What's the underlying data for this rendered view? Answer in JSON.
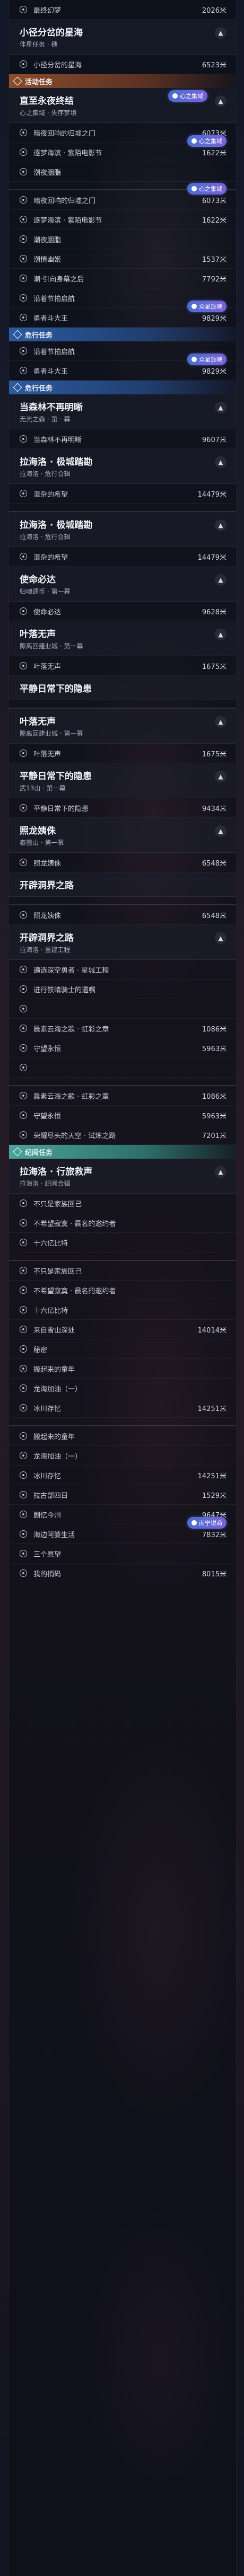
{
  "colors": {
    "main": "#8a4d2d",
    "side": "#2c5aa0",
    "world": "#4aa39a",
    "badge": "#5f68d4"
  },
  "units": "米",
  "rows": [
    {
      "t": "row",
      "label": "最终幻梦",
      "dist": "2026米"
    },
    {
      "t": "header",
      "title": "小径分岔的星海",
      "sub": "伴星任务 · 穗",
      "chev": "▲"
    },
    {
      "t": "row",
      "label": "小径分岔的星海",
      "dist": "6523米"
    },
    {
      "t": "section",
      "kind": "main",
      "label": "活动任务"
    },
    {
      "t": "header",
      "title": "直至永夜终结",
      "sub": "心之集域 · 失序梦境",
      "chev": "▲",
      "badge": "心之集域"
    },
    {
      "t": "row",
      "label": "暗夜回响的归墟之门",
      "dist": "6073米"
    },
    {
      "t": "row",
      "label": "逐梦海滨 · 紫陌电影节",
      "dist": "1622米",
      "badge": "心之集域"
    },
    {
      "t": "row",
      "label": "潮夜胭脂",
      "dist": ""
    },
    {
      "t": "divider"
    },
    {
      "t": "row",
      "label": "暗夜回响的归墟之门",
      "dist": "6073米",
      "badge": "心之集域"
    },
    {
      "t": "row",
      "label": "逐梦海滨 · 紫陌电影节",
      "dist": "1622米"
    },
    {
      "t": "row",
      "label": "潮夜胭脂",
      "dist": ""
    },
    {
      "t": "row",
      "label": "潮情幽姬",
      "dist": "1537米"
    },
    {
      "t": "row",
      "label": "潮·引向身幕之后",
      "dist": "7792米"
    },
    {
      "t": "row",
      "label": "沿着节拍启航",
      "dist": ""
    },
    {
      "t": "row",
      "label": "勇者斗大王",
      "dist": "9829米",
      "badge": "众星放映"
    },
    {
      "t": "section",
      "kind": "side",
      "label": "危行任务"
    },
    {
      "t": "row",
      "label": "沿着节拍启航",
      "dist": ""
    },
    {
      "t": "row",
      "label": "勇者斗大王",
      "dist": "9829米",
      "badge": "众星放映"
    },
    {
      "t": "section",
      "kind": "side",
      "label": "危行任务"
    },
    {
      "t": "header",
      "title": "当森林不再明晰",
      "sub": "无光之森 · 第一幕",
      "chev": "▲"
    },
    {
      "t": "row",
      "label": "当森林不再明晰",
      "dist": "9607米"
    },
    {
      "t": "header",
      "title": "拉海洛 · 极城踏勘",
      "sub": "拉海洛 · 危行合辑",
      "chev": "▲"
    },
    {
      "t": "row",
      "label": "混杂的希望",
      "dist": "14479米"
    },
    {
      "t": "divider"
    },
    {
      "t": "header",
      "title": "拉海洛 · 极城踏勘",
      "sub": "拉海洛 · 危行合辑",
      "chev": "▲"
    },
    {
      "t": "row",
      "label": "混杂的希望",
      "dist": "14479米"
    },
    {
      "t": "header",
      "title": "使命必达",
      "sub": "归魂遗币 · 第一幕",
      "chev": "▲"
    },
    {
      "t": "row",
      "label": "使命必达",
      "dist": "9628米"
    },
    {
      "t": "header",
      "title": "叶落无声",
      "sub": "隙离回建业城 · 第一幕",
      "chev": "▲"
    },
    {
      "t": "row",
      "label": "叶落无声",
      "dist": "1675米"
    },
    {
      "t": "header",
      "title": "平静日常下的隐患",
      "sub": "",
      "chev": ""
    },
    {
      "t": "divider"
    },
    {
      "t": "header",
      "title": "叶落无声",
      "sub": "隙离回建业城 · 第一幕",
      "chev": "▲"
    },
    {
      "t": "row",
      "label": "叶落无声",
      "dist": "1675米"
    },
    {
      "t": "header",
      "title": "平静日常下的隐患",
      "sub": "武13山 · 第一幕",
      "chev": "▲"
    },
    {
      "t": "row",
      "label": "平静日常下的隐患",
      "dist": "9434米"
    },
    {
      "t": "header",
      "title": "照龙姨侏",
      "sub": "泰茵山 · 第一幕",
      "chev": "▲"
    },
    {
      "t": "row",
      "label": "照龙姨侏",
      "dist": "6548米"
    },
    {
      "t": "header",
      "title": "开辟洞界之路",
      "sub": "",
      "chev": ""
    },
    {
      "t": "divider"
    },
    {
      "t": "row",
      "label": "照龙姨侏",
      "dist": "6548米"
    },
    {
      "t": "header",
      "title": "开辟洞界之路",
      "sub": "拉海洛 · 重建工程",
      "chev": "▲"
    },
    {
      "t": "row",
      "label": "遍选深空勇者 · 星城工程",
      "dist": ""
    },
    {
      "t": "row",
      "label": "进行铁晴骑士的遗嘱",
      "dist": ""
    },
    {
      "t": "row",
      "label": "",
      "dist": ""
    },
    {
      "t": "row",
      "label": "晨素云海之歌 · 虹彩之章",
      "dist": "1086米"
    },
    {
      "t": "row",
      "label": "守望永恒",
      "dist": "5963米"
    },
    {
      "t": "row",
      "label": "",
      "dist": ""
    },
    {
      "t": "divider"
    },
    {
      "t": "row",
      "label": "晨素云海之歌 · 虹彩之章",
      "dist": "1086米"
    },
    {
      "t": "row",
      "label": "守望永恒",
      "dist": "5963米"
    },
    {
      "t": "row",
      "label": "荣耀尽头的天空 · 试炼之路",
      "dist": "7201米"
    },
    {
      "t": "section",
      "kind": "world",
      "label": "纪闻任务"
    },
    {
      "t": "header",
      "title": "拉海洛 · 行旅救声",
      "sub": "拉海洛 · 纪闻合辑",
      "chev": "▲"
    },
    {
      "t": "row",
      "label": "不只是家族回己",
      "dist": ""
    },
    {
      "t": "row",
      "label": "不希望寂寞 · 晨名的邀约者",
      "dist": ""
    },
    {
      "t": "row",
      "label": "十六亿比特",
      "dist": ""
    },
    {
      "t": "divider"
    },
    {
      "t": "row",
      "label": "不只是家族回己",
      "dist": ""
    },
    {
      "t": "row",
      "label": "不希望寂寞 · 晨名的邀约者",
      "dist": ""
    },
    {
      "t": "row",
      "label": "十六亿比特",
      "dist": ""
    },
    {
      "t": "row",
      "label": "来自雪山深处",
      "dist": "14014米"
    },
    {
      "t": "row",
      "label": "秘密",
      "dist": ""
    },
    {
      "t": "row",
      "label": "搬起来的童年",
      "dist": ""
    },
    {
      "t": "row",
      "label": "龙海加油（一）",
      "dist": ""
    },
    {
      "t": "row",
      "label": "冰川存忆",
      "dist": "14251米"
    },
    {
      "t": "divider"
    },
    {
      "t": "row",
      "label": "搬起来的童年",
      "dist": ""
    },
    {
      "t": "row",
      "label": "龙海加油（一）",
      "dist": ""
    },
    {
      "t": "row",
      "label": "冰川存忆",
      "dist": "14251米"
    },
    {
      "t": "row",
      "label": "拉古部四日",
      "dist": "1529米"
    },
    {
      "t": "row",
      "label": "剧忆今州",
      "dist": "9647米"
    },
    {
      "t": "row",
      "label": "海边阿婆生活",
      "dist": "7832米",
      "badge": "南宁锐商"
    },
    {
      "t": "row",
      "label": "三个愿望",
      "dist": ""
    },
    {
      "t": "row",
      "label": "我的捎码",
      "dist": "8015米"
    }
  ]
}
